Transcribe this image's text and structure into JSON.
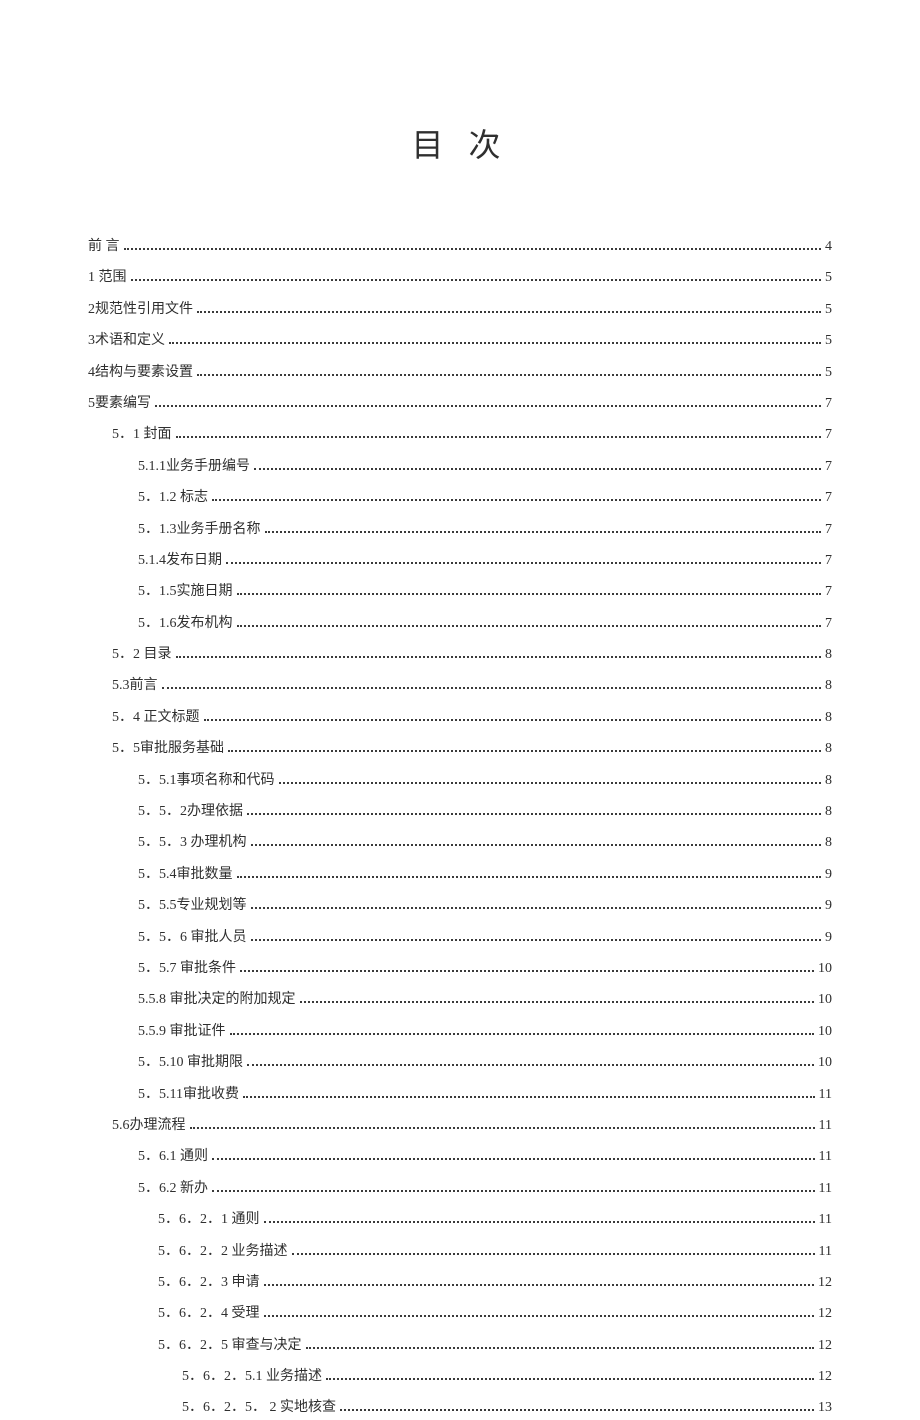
{
  "title": "目 次",
  "entries": [
    {
      "level": 1,
      "label": "前 言",
      "page": "4"
    },
    {
      "level": 1,
      "label": "1 范围",
      "page": "5"
    },
    {
      "level": 1,
      "label": "2规范性引用文件",
      "page": "5"
    },
    {
      "level": 1,
      "label": "3术语和定义",
      "page": "5"
    },
    {
      "level": 1,
      "label": "4结构与要素设置",
      "page": "5"
    },
    {
      "level": 1,
      "label": "5要素编写",
      "page": "7"
    },
    {
      "level": 2,
      "label": "5．1 封面",
      "page": "7"
    },
    {
      "level": 3,
      "label": "5.1.1业务手册编号",
      "page": "7"
    },
    {
      "level": 3,
      "label": "5．1.2 标志",
      "page": "7"
    },
    {
      "level": 3,
      "label": "5．1.3业务手册名称",
      "page": "7"
    },
    {
      "level": 3,
      "label": "5.1.4发布日期",
      "page": "7"
    },
    {
      "level": 3,
      "label": "5．1.5实施日期",
      "page": "7"
    },
    {
      "level": 3,
      "label": "5．1.6发布机构",
      "page": "7"
    },
    {
      "level": 2,
      "label": "5．2 目录",
      "page": "8"
    },
    {
      "level": 2,
      "label": "5.3前言",
      "page": "8"
    },
    {
      "level": 2,
      "label": "5．4 正文标题",
      "page": "8"
    },
    {
      "level": 2,
      "label": "5．5审批服务基础",
      "page": "8"
    },
    {
      "level": 3,
      "label": "5．5.1事项名称和代码",
      "page": "8"
    },
    {
      "level": 3,
      "label": "5．5．2办理依据",
      "page": "8"
    },
    {
      "level": 3,
      "label": "5．5．3  办理机构",
      "page": "8"
    },
    {
      "level": 3,
      "label": "5．5.4审批数量",
      "page": "9"
    },
    {
      "level": 3,
      "label": "5．5.5专业规划等",
      "page": "9"
    },
    {
      "level": 3,
      "label": "5．5．6  审批人员",
      "page": "9"
    },
    {
      "level": 3,
      "label": "5．5.7  审批条件",
      "page": "10"
    },
    {
      "level": 3,
      "label": "5.5.8      审批决定的附加规定",
      "page": "10"
    },
    {
      "level": 3,
      "label": "5.5.9      审批证件",
      "page": "10"
    },
    {
      "level": 3,
      "label": "5．5.10  审批期限",
      "page": "10"
    },
    {
      "level": 3,
      "label": "5．5.11审批收费",
      "page": "11"
    },
    {
      "level": 2,
      "label": "5.6办理流程",
      "page": "11"
    },
    {
      "level": 3,
      "label": "5．6.1  通则",
      "page": "11"
    },
    {
      "level": 3,
      "label": "5．6.2  新办",
      "page": "11"
    },
    {
      "level": 4,
      "label": "5．6．2．1 通则",
      "page": "11"
    },
    {
      "level": 4,
      "label": "5．6．2．2  业务描述",
      "page": "11"
    },
    {
      "level": 4,
      "label": "5．6．2．3 申请",
      "page": "12"
    },
    {
      "level": 4,
      "label": "5．6．2．4  受理",
      "page": "12"
    },
    {
      "level": 4,
      "label": "5．6．2．5  审查与决定",
      "page": "12"
    },
    {
      "level": 5,
      "label": "5．6．2．5.1  业务描述",
      "page": "12"
    },
    {
      "level": 5,
      "label": "5．6．2．5．  2    实地核查",
      "page": "13"
    }
  ]
}
